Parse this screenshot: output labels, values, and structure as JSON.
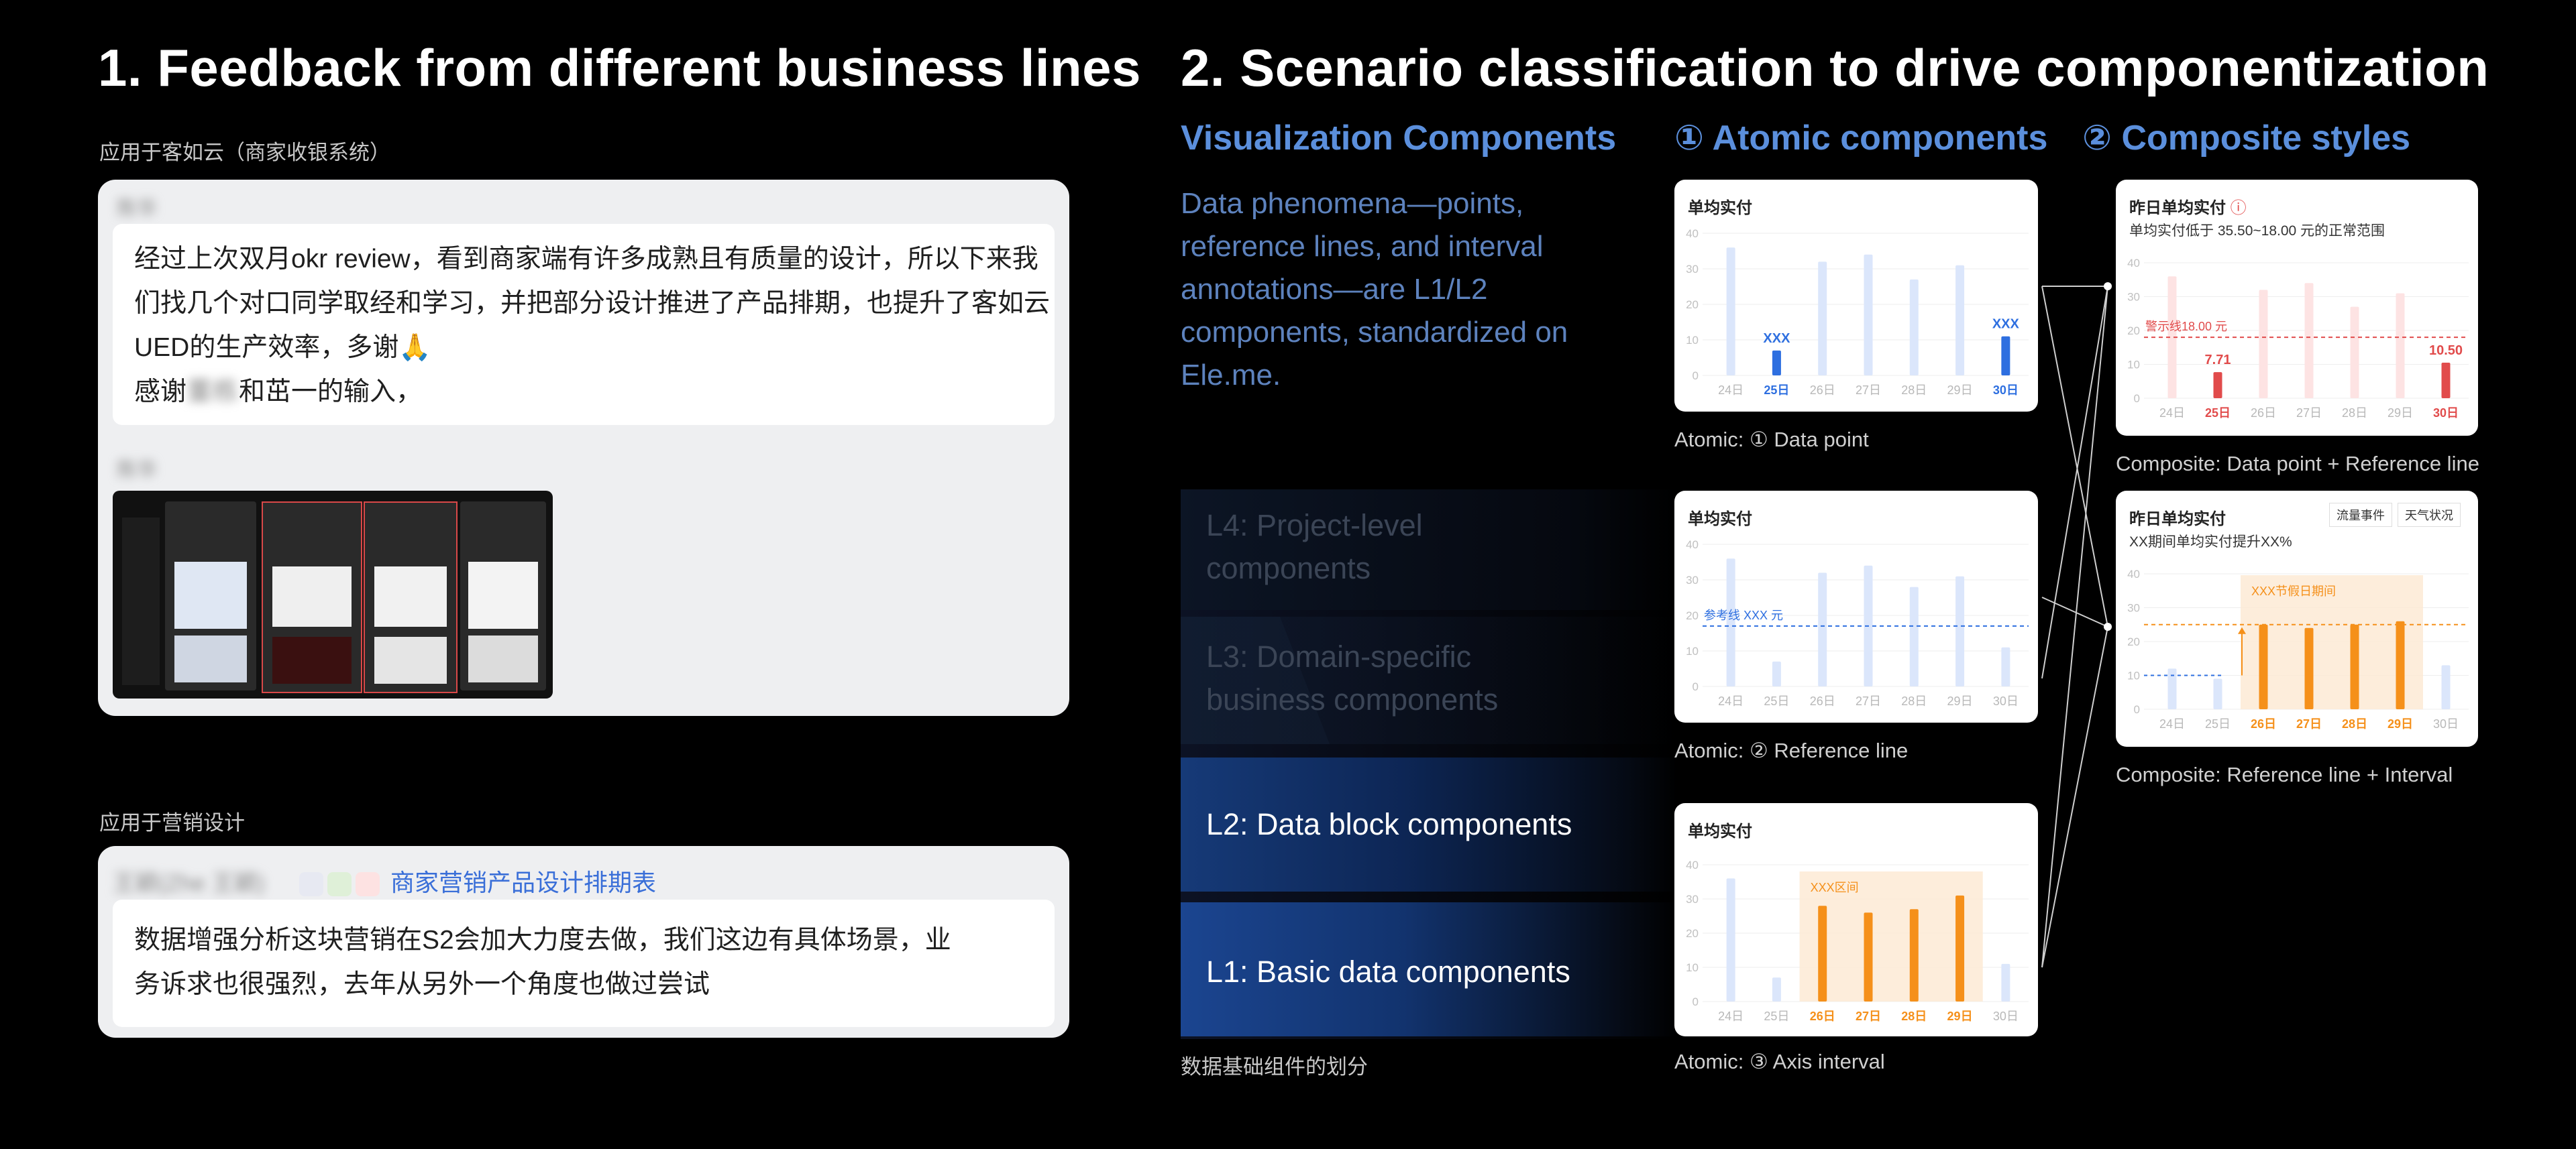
{
  "left": {
    "title": "1. Feedback from different business lines",
    "section1": {
      "caption": "应用于客如云（商家收银系统）",
      "sender_blurred": "陈华",
      "message_lines": [
        "经过上次双月okr review，看到商家端有许多成熟且有质量的设计，所以下来我",
        "们找几个对口同学取经和学习，并把部分设计推进了产品排期，也提升了客如云",
        "UED的生产效率，多谢🙏"
      ],
      "thanks_prefix": "感谢",
      "thanks_blurred": "董栋",
      "thanks_suffix": "和茁一的输入，",
      "sender2_blurred": "陈华"
    },
    "section2": {
      "caption": "应用于营销设计",
      "sender_blurred": "王颖(Zhe 王颖)",
      "link_text": "商家营销产品设计排期表",
      "message_lines": [
        "数据增强分析这块营销在S2会加大力度去做，我们这边有具体场景，业",
        "务诉求也很强烈，去年从另外一个角度也做过尝试"
      ]
    }
  },
  "right": {
    "title": "2. Scenario classification to drive componentization",
    "viz": {
      "heading": "Visualization Components",
      "desc_lines": [
        "Data phenomena—points,",
        "reference lines, and interval",
        "annotations—are L1/L2",
        "components, standardized on",
        "Ele.me."
      ],
      "layers": [
        "L4: Project-level components",
        "L3: Domain-specific business components",
        "L2: Data block components",
        "L1: Basic data components"
      ],
      "caption": "数据基础组件的划分"
    },
    "atomic": {
      "heading": "① Atomic components",
      "captions": [
        "Atomic: ① Data point",
        "Atomic: ② Reference line",
        "Atomic: ③ Axis interval"
      ]
    },
    "composite": {
      "heading": "② Composite styles",
      "captions": [
        "Composite: Data point + Reference line",
        "Composite: Reference line + Interval"
      ]
    }
  },
  "chart_data": [
    {
      "type": "bar",
      "title": "单均实付",
      "categories": [
        "24日",
        "25日",
        "26日",
        "27日",
        "28日",
        "29日",
        "30日"
      ],
      "values": [
        36,
        7,
        32,
        34,
        27,
        31,
        11
      ],
      "highlight": [
        1,
        6
      ],
      "data_labels": [
        "XXX",
        "XXX"
      ],
      "ylim": [
        0,
        40
      ],
      "yticks": [
        "40",
        "30",
        "20",
        "10",
        "0"
      ]
    },
    {
      "type": "bar",
      "title": "单均实付",
      "categories": [
        "24日",
        "25日",
        "26日",
        "27日",
        "28日",
        "29日",
        "30日"
      ],
      "values": [
        36,
        7,
        32,
        34,
        28,
        31,
        11
      ],
      "reference_line": {
        "value": 17,
        "label": "参考线 XXX 元"
      },
      "ylim": [
        0,
        40
      ],
      "yticks": [
        "40",
        "30",
        "20",
        "10",
        "0"
      ]
    },
    {
      "type": "bar",
      "title": "单均实付",
      "categories": [
        "24日",
        "25日",
        "26日",
        "27日",
        "28日",
        "29日",
        "30日"
      ],
      "values": [
        36,
        7,
        28,
        26,
        27,
        31,
        11
      ],
      "interval": {
        "from": 2,
        "to": 5,
        "label": "XXX区间"
      },
      "ylim": [
        0,
        40
      ],
      "yticks": [
        "40",
        "30",
        "20",
        "10",
        "0"
      ]
    },
    {
      "type": "bar",
      "title": "昨日单均实付",
      "subtitle": "单均实付低于 35.50~18.00 元的正常范围",
      "categories": [
        "24日",
        "25日",
        "26日",
        "27日",
        "28日",
        "29日",
        "30日"
      ],
      "values": [
        36,
        7.71,
        32,
        34,
        27,
        31,
        10.5
      ],
      "highlight": [
        1,
        6
      ],
      "data_labels": [
        "7.71",
        "10.50"
      ],
      "reference_line": {
        "value": 18,
        "label": "警示线18.00 元"
      },
      "ylim": [
        0,
        40
      ],
      "yticks": [
        "40",
        "30",
        "20",
        "10",
        "0"
      ]
    },
    {
      "type": "bar",
      "title": "昨日单均实付",
      "subtitle": "XX期间单均实付提升XX%",
      "tabs": [
        "流量事件",
        "天气状况"
      ],
      "categories": [
        "24日",
        "25日",
        "26日",
        "27日",
        "28日",
        "29日",
        "30日"
      ],
      "values": [
        12,
        9,
        25,
        24,
        25,
        26,
        13
      ],
      "interval": {
        "from": 2,
        "to": 5,
        "label": "XXX节假日期间"
      },
      "reference_line": {
        "value": 25,
        "label": ""
      },
      "ylim": [
        0,
        40
      ],
      "yticks": [
        "40",
        "30",
        "20",
        "10",
        "0"
      ]
    }
  ],
  "colors": {
    "blue": "#2e6fe0",
    "pale_blue": "#dbe6fb",
    "orange": "#f5901a",
    "red": "#e14b4b",
    "pale_red": "#fde3e3",
    "heading_blue": "#5b8fdc"
  }
}
